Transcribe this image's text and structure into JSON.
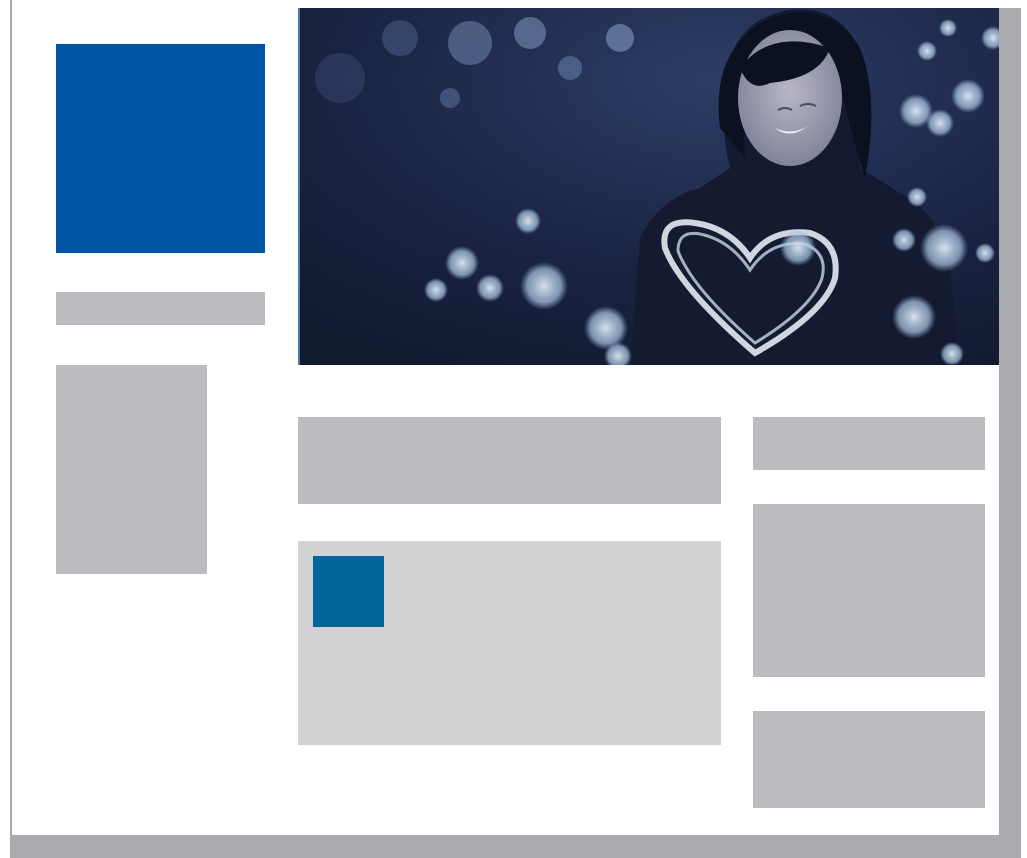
{
  "colors": {
    "logo_blue": "#0055a5",
    "placeholder_gray": "#bcbcc0",
    "card_gray": "#d2d3d5",
    "thumb_blue": "#006699",
    "shadow_gray": "#a9aaad",
    "hero_night": "#1b2540"
  },
  "hero": {
    "image": "photo-woman-holding-glowing-heart-lights-at-night"
  },
  "icons": {
    "logo": "logo-placeholder",
    "card_thumb": "thumbnail-placeholder"
  }
}
